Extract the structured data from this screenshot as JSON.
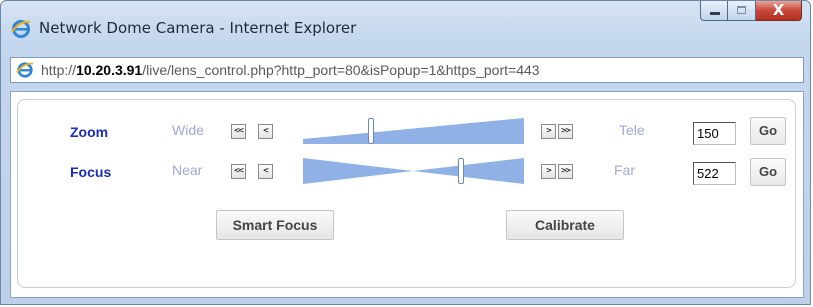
{
  "window": {
    "title": "Network Dome Camera - Internet Explorer",
    "controls": {
      "minimize": "minimize",
      "maximize": "maximize",
      "close_glyph": "X"
    }
  },
  "address": {
    "prefix": "http://",
    "host": "10.20.3.91",
    "path": "/live/lens_control.php?http_port=80&isPopup=1&https_port=443"
  },
  "lens": {
    "zoom": {
      "label": "Zoom",
      "min_label": "Wide",
      "max_label": "Tele",
      "step_back_fast": "<<",
      "step_back": "<",
      "step_fwd": ">",
      "step_fwd_fast": ">>",
      "value": "150",
      "slider_level": 0.3,
      "go_label": "Go"
    },
    "focus": {
      "label": "Focus",
      "min_label": "Near",
      "max_label": "Far",
      "step_back_fast": "<<",
      "step_back": "<",
      "step_fwd": ">",
      "step_fwd_fast": ">>",
      "value": "522",
      "slider_level": 0.72,
      "go_label": "Go"
    },
    "smart_focus_label": "Smart Focus",
    "calibrate_label": "Calibrate"
  },
  "colors": {
    "label_blue": "#1a2bbd",
    "range_label": "#a3a7d6",
    "slider_fill": "#8fb1e6"
  },
  "icons": {
    "browser": "internet-explorer-icon"
  }
}
